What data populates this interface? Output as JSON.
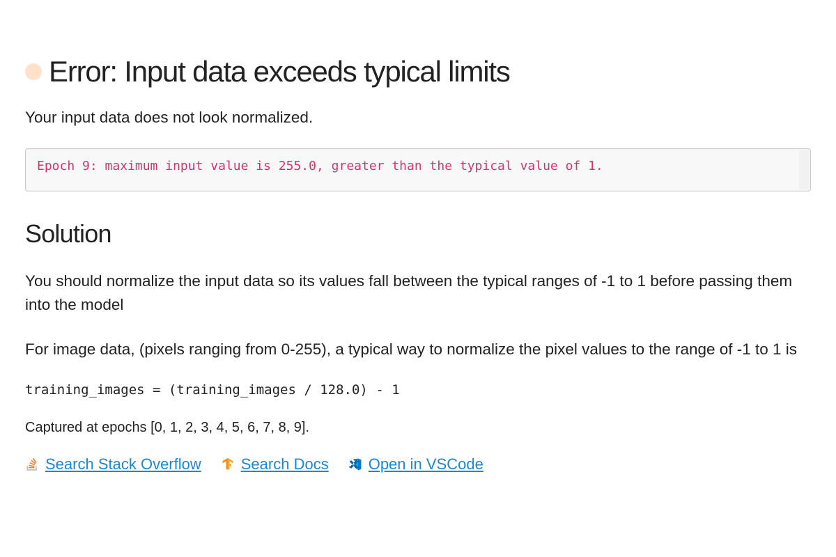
{
  "error": {
    "title": "Error: Input data exceeds typical limits",
    "lead": "Your input data does not look normalized.",
    "message": "Epoch 9: maximum input value is 255.0, greater than the typical value of 1."
  },
  "solution": {
    "heading": "Solution",
    "para1": "You should normalize the input data so its values fall between the typical ranges of -1 to 1 before passing them into the model",
    "para2": "For image data, (pixels ranging from 0-255), a typical way to normalize the pixel values to the range of -1 to 1 is",
    "code": "training_images = (training_images / 128.0) - 1",
    "captured": "Captured at epochs [0, 1, 2, 3, 4, 5, 6, 7, 8, 9]."
  },
  "links": {
    "stackoverflow": "Search Stack Overflow",
    "docs": "Search Docs",
    "vscode": "Open in VSCode"
  }
}
